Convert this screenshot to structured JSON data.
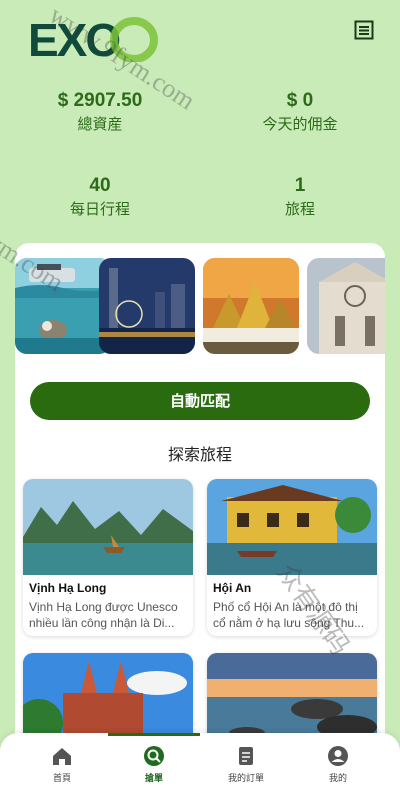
{
  "header": {
    "logo_text": "EXO",
    "menu_icon": "menu-list-icon"
  },
  "stats": [
    {
      "value": "$ 2907.50",
      "label": "總資産"
    },
    {
      "value": "$ 0",
      "label": "今天的佣金"
    },
    {
      "value": "40",
      "label": "每日行程"
    },
    {
      "value": "1",
      "label": "旅程"
    }
  ],
  "carousel": [
    "underwater-snorkeling",
    "city-ferris-wheel-night",
    "golden-temple-sunset",
    "gothic-cathedral"
  ],
  "match_button": "自動匹配",
  "explore_title": "探索旅程",
  "destinations": [
    {
      "name": "Vịnh Hạ Long",
      "desc": "Vịnh Hạ Long được Unesco nhiều lần công nhận là Di..."
    },
    {
      "name": "Hội An",
      "desc": "Phố cổ Hội An là một đô thị cổ nằm ở hạ lưu sông Thu..."
    },
    {
      "name": "",
      "desc": ""
    },
    {
      "name": "",
      "desc": ""
    }
  ],
  "nav": [
    {
      "label": "首頁",
      "icon": "home-icon"
    },
    {
      "label": "搶單",
      "icon": "search-icon"
    },
    {
      "label": "我的訂單",
      "icon": "orders-icon"
    },
    {
      "label": "我的",
      "icon": "profile-icon"
    }
  ],
  "watermark": [
    "www.9fym.com",
    "9fym.com",
    "众有源码"
  ],
  "colors": {
    "background": "#c9ebb8",
    "primary": "#2a6b0f",
    "stat_text": "#2d6a1a"
  }
}
